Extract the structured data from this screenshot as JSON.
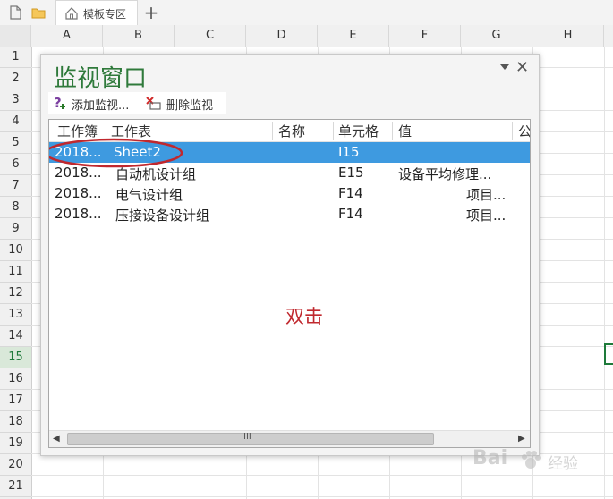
{
  "tabbar": {
    "template_tab_label": "模板专区",
    "add_tab": "+"
  },
  "columns": [
    "A",
    "B",
    "C",
    "D",
    "E",
    "F",
    "G",
    "H"
  ],
  "rows": [
    "1",
    "2",
    "3",
    "4",
    "5",
    "6",
    "7",
    "8",
    "9",
    "10",
    "11",
    "12",
    "13",
    "14",
    "15",
    "16",
    "17",
    "18",
    "19",
    "20",
    "21"
  ],
  "active_row": "15",
  "watch_window": {
    "title": "监视窗口",
    "add_button": "添加监视...",
    "delete_button": "删除监视",
    "headers": {
      "workbook": "工作簿",
      "sheet": "工作表",
      "name": "名称",
      "cell": "单元格",
      "value": "值",
      "formula": "公"
    },
    "rows": [
      {
        "workbook": "2018...",
        "sheet": "Sheet2",
        "name": "",
        "cell": "I15",
        "value": "",
        "selected": true
      },
      {
        "workbook": "2018...",
        "sheet": "自动机设计组",
        "name": "",
        "cell": "E15",
        "value": "设备平均修理...",
        "selected": false
      },
      {
        "workbook": "2018...",
        "sheet": "电气设计组",
        "name": "",
        "cell": "F14",
        "value": "项目...",
        "selected": false
      },
      {
        "workbook": "2018...",
        "sheet": "压接设备设计组",
        "name": "",
        "cell": "F14",
        "value": "项目...",
        "selected": false
      }
    ],
    "annotation": "双击",
    "scroll_grip": "III"
  },
  "watermark": {
    "text": "Bai",
    "cn": "经验"
  },
  "colors": {
    "title_green": "#2f7a3b",
    "selection_blue": "#3e9ae0",
    "annotation_red": "#c0282e"
  }
}
